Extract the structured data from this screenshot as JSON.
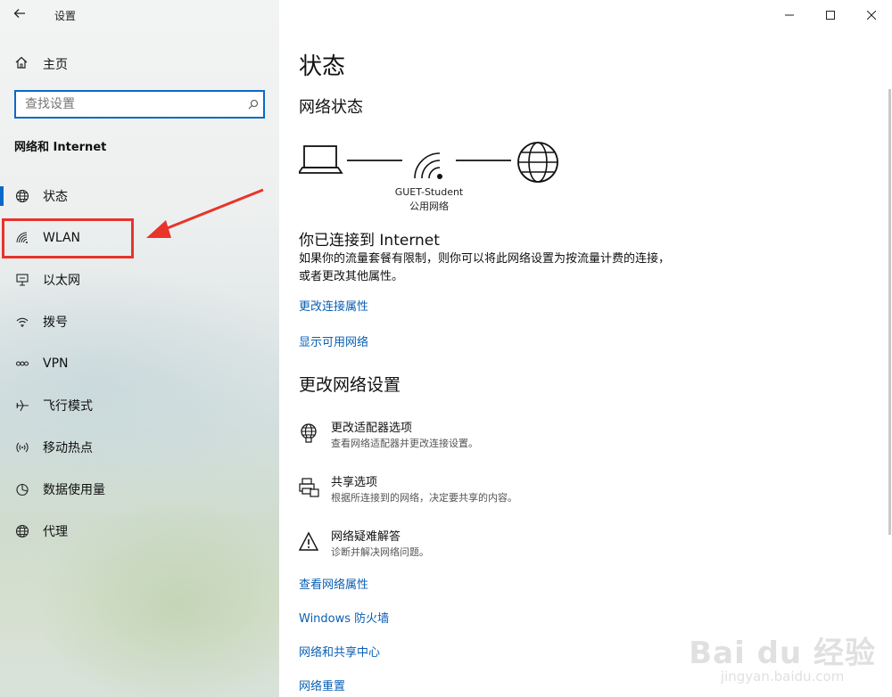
{
  "window": {
    "title": "设置",
    "back_icon": "back-arrow-icon",
    "controls": [
      "minimize-icon",
      "maximize-icon",
      "close-icon"
    ]
  },
  "sidebar": {
    "home_label": "主页",
    "search_placeholder": "查找设置",
    "section_title": "网络和 Internet",
    "items": [
      {
        "label": "状态",
        "icon": "globe-icon"
      },
      {
        "label": "WLAN",
        "icon": "wifi-icon"
      },
      {
        "label": "以太网",
        "icon": "ethernet-icon"
      },
      {
        "label": "拨号",
        "icon": "dialup-icon"
      },
      {
        "label": "VPN",
        "icon": "vpn-icon"
      },
      {
        "label": "飞行模式",
        "icon": "airplane-icon"
      },
      {
        "label": "移动热点",
        "icon": "hotspot-icon"
      },
      {
        "label": "数据使用量",
        "icon": "pie-chart-icon"
      },
      {
        "label": "代理",
        "icon": "globe-icon"
      }
    ],
    "active_index": 0,
    "annotation_color": "#e8342b"
  },
  "main": {
    "title": "状态",
    "network_status_title": "网络状态",
    "network_name": "GUET-Student",
    "network_type": "公用网络",
    "connected_title": "你已连接到 Internet",
    "connected_desc": "如果你的流量套餐有限制，则你可以将此网络设置为按流量计费的连接，或者更改其他属性。",
    "links_top": [
      "更改连接属性",
      "显示可用网络"
    ],
    "change_title": "更改网络设置",
    "options": [
      {
        "title": "更改适配器选项",
        "desc": "查看网络适配器并更改连接设置。",
        "icon": "adapter-globe-icon"
      },
      {
        "title": "共享选项",
        "desc": "根据所连接到的网络，决定要共享的内容。",
        "icon": "printer-share-icon"
      },
      {
        "title": "网络疑难解答",
        "desc": "诊断并解决网络问题。",
        "icon": "warning-icon"
      }
    ],
    "links_bottom": [
      "查看网络属性",
      "Windows 防火墙",
      "网络和共享中心",
      "网络重置"
    ],
    "accent_color": "#0a5fb4"
  },
  "watermark": {
    "line1": "Bai du 经验",
    "line2": "jingyan.baidu.com"
  }
}
